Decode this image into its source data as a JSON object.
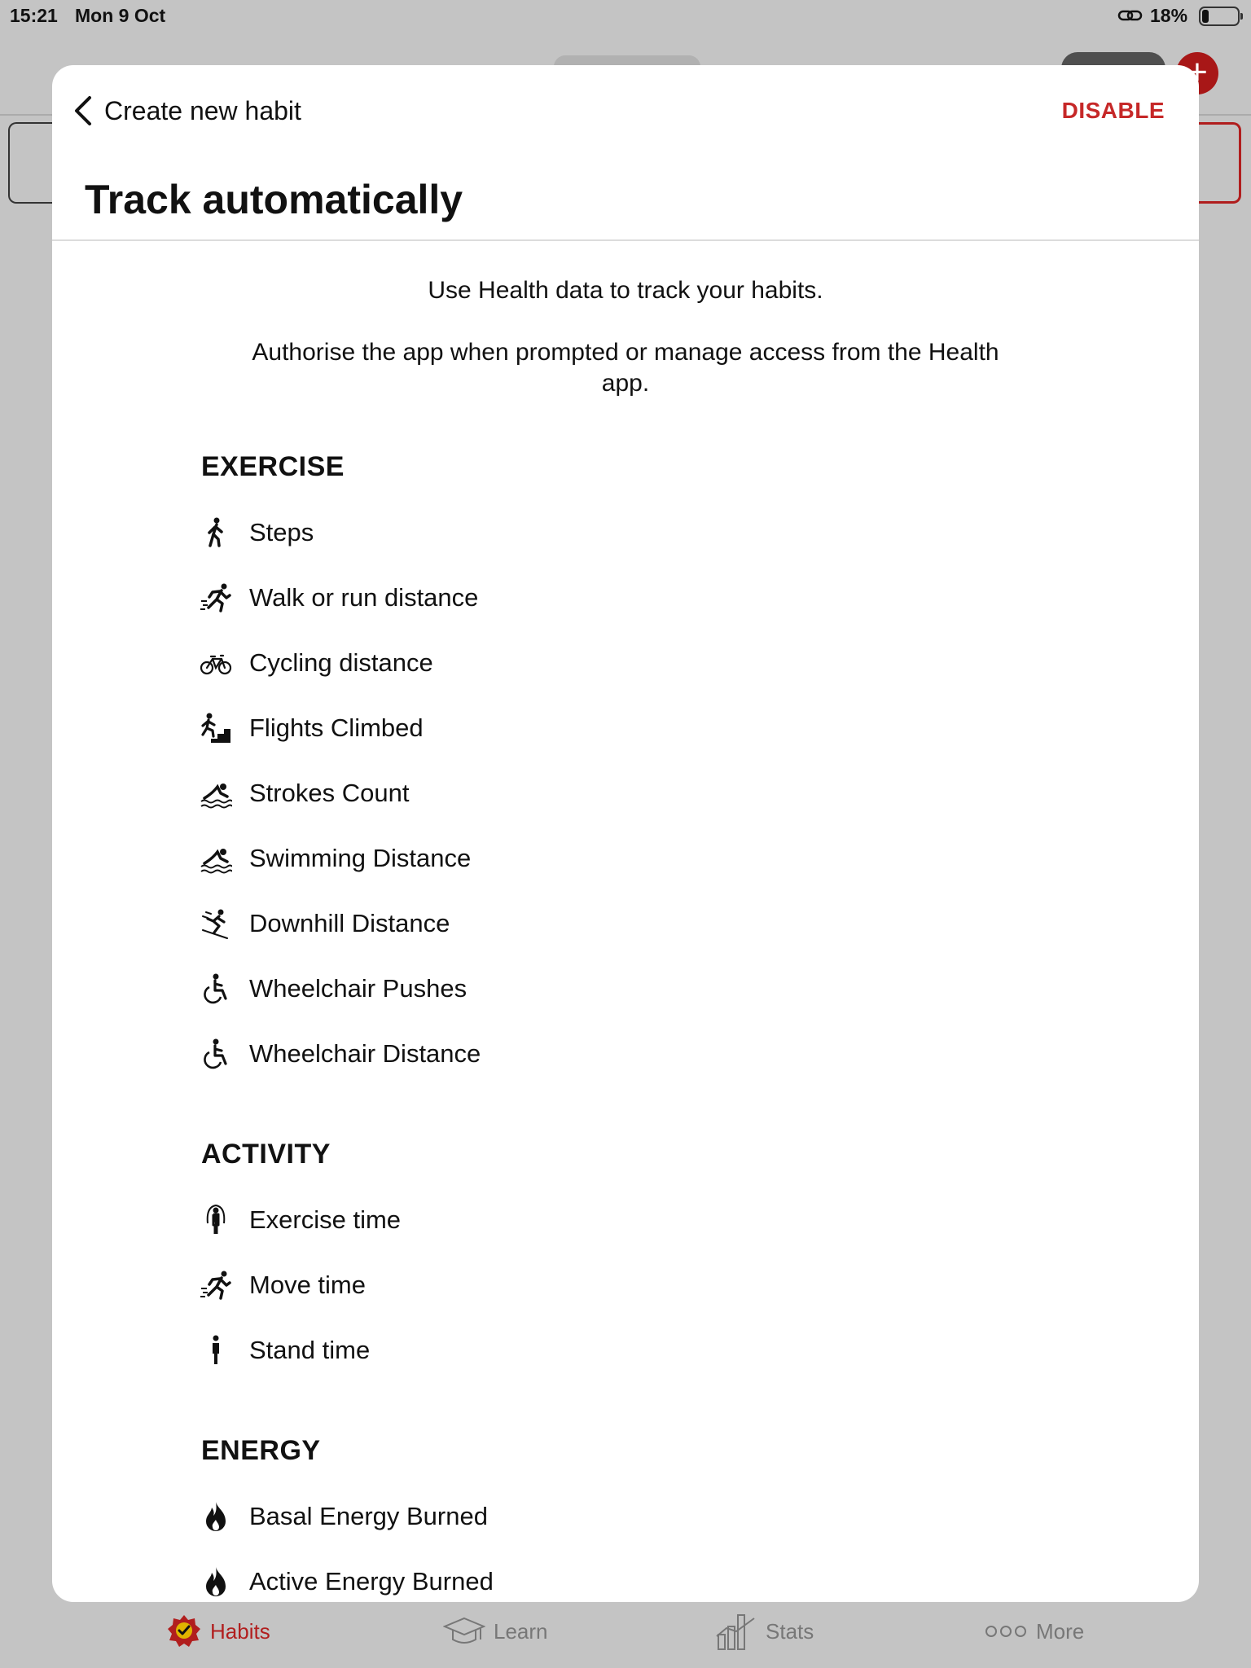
{
  "status_bar": {
    "time": "15:21",
    "date": "Mon 9 Oct",
    "battery": "18%"
  },
  "header": {
    "back_label": "Create new habit",
    "disable_label": "DISABLE",
    "title": "Track automatically"
  },
  "intro": {
    "line1": "Use Health data to track your habits.",
    "line2": "Authorise the app when prompted or manage access from the Health app."
  },
  "sections": {
    "exercise": {
      "title": "EXERCISE",
      "items": [
        {
          "label": "Steps",
          "icon": "walking-icon"
        },
        {
          "label": "Walk or run distance",
          "icon": "running-icon"
        },
        {
          "label": "Cycling distance",
          "icon": "bicycle-icon"
        },
        {
          "label": "Flights Climbed",
          "icon": "stairs-climb-icon"
        },
        {
          "label": "Strokes Count",
          "icon": "swimming-icon"
        },
        {
          "label": "Swimming Distance",
          "icon": "swimming-icon"
        },
        {
          "label": "Downhill Distance",
          "icon": "skiing-icon"
        },
        {
          "label": "Wheelchair Pushes",
          "icon": "wheelchair-icon"
        },
        {
          "label": "Wheelchair Distance",
          "icon": "wheelchair-icon"
        }
      ]
    },
    "activity": {
      "title": "ACTIVITY",
      "items": [
        {
          "label": "Exercise time",
          "icon": "jump-rope-icon"
        },
        {
          "label": "Move time",
          "icon": "running-icon"
        },
        {
          "label": "Stand time",
          "icon": "standing-figure-icon"
        }
      ]
    },
    "energy": {
      "title": "ENERGY",
      "items": [
        {
          "label": "Basal Energy Burned",
          "icon": "flame-icon"
        },
        {
          "label": "Active Energy Burned",
          "icon": "flame-icon"
        }
      ]
    }
  },
  "tabbar": {
    "habits": "Habits",
    "learn": "Learn",
    "stats": "Stats",
    "more": "More"
  },
  "colors": {
    "accent": "#c62828",
    "overlay": "#c4c4c4"
  }
}
